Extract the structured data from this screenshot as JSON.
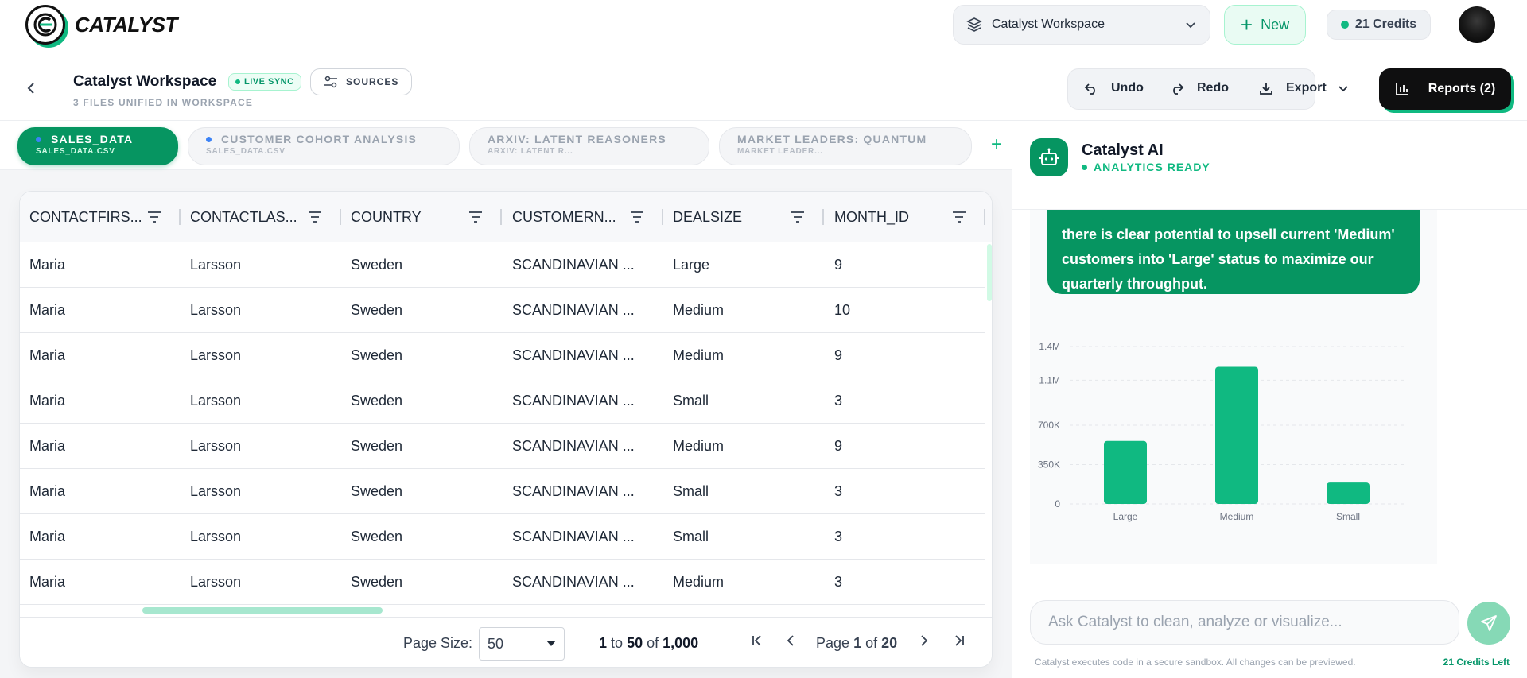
{
  "app": {
    "name": "CATALYST"
  },
  "topbar": {
    "workspace_selector": "Catalyst Workspace",
    "new_label": "New",
    "credits": "21 Credits"
  },
  "subbar": {
    "title": "Catalyst Workspace",
    "live_sync": "LIVE SYNC",
    "sources": "SOURCES",
    "subtitle": "3 FILES UNIFIED IN WORKSPACE",
    "undo": "Undo",
    "redo": "Redo",
    "export": "Export",
    "reports": "Reports (2)"
  },
  "tabs": [
    {
      "title": "SALES_DATA",
      "file": "SALES_DATA.CSV",
      "active": true
    },
    {
      "title": "CUSTOMER COHORT ANALYSIS",
      "file": "SALES_DATA.CSV",
      "active": false
    },
    {
      "title": "ARXIV: LATENT REASONERS",
      "file": "ARXIV: LATENT R...",
      "active": false
    },
    {
      "title": "MARKET LEADERS: QUANTUM",
      "file": "MARKET LEADER...",
      "active": false
    }
  ],
  "table": {
    "columns": [
      "CONTACTFIRS...",
      "CONTACTLAS...",
      "COUNTRY",
      "CUSTOMERN...",
      "DEALSIZE",
      "MONTH_ID"
    ],
    "rows": [
      [
        "Maria",
        "Larsson",
        "Sweden",
        "SCANDINAVIAN ...",
        "Large",
        "9"
      ],
      [
        "Maria",
        "Larsson",
        "Sweden",
        "SCANDINAVIAN ...",
        "Medium",
        "10"
      ],
      [
        "Maria",
        "Larsson",
        "Sweden",
        "SCANDINAVIAN ...",
        "Medium",
        "9"
      ],
      [
        "Maria",
        "Larsson",
        "Sweden",
        "SCANDINAVIAN ...",
        "Small",
        "3"
      ],
      [
        "Maria",
        "Larsson",
        "Sweden",
        "SCANDINAVIAN ...",
        "Medium",
        "9"
      ],
      [
        "Maria",
        "Larsson",
        "Sweden",
        "SCANDINAVIAN ...",
        "Small",
        "3"
      ],
      [
        "Maria",
        "Larsson",
        "Sweden",
        "SCANDINAVIAN ...",
        "Small",
        "3"
      ],
      [
        "Maria",
        "Larsson",
        "Sweden",
        "SCANDINAVIAN ...",
        "Medium",
        "3"
      ]
    ]
  },
  "pager": {
    "page_size_label": "Page Size:",
    "page_size": "50",
    "range_from": "1",
    "range_to": "50",
    "total": "1,000",
    "to": "to",
    "of": "of",
    "page_label": "Page",
    "page": "1",
    "page_of": "of",
    "pages": "20"
  },
  "ai": {
    "title": "Catalyst AI",
    "status": "ANALYTICS READY",
    "message": "there is clear potential to upsell current 'Medium' customers into 'Large' status to maximize our quarterly throughput.",
    "input_placeholder": "Ask Catalyst to clean, analyze or visualize...",
    "footnote": "Catalyst executes code in a secure sandbox. All changes can be previewed.",
    "credits_left": "21 Credits Left"
  },
  "colors": {
    "accent": "#069561",
    "bar": "#10b981"
  },
  "chart_data": {
    "type": "bar",
    "categories": [
      "Large",
      "Medium",
      "Small"
    ],
    "values": [
      560000,
      1220000,
      190000
    ],
    "ylim": [
      0,
      1400000
    ],
    "yticks": [
      0,
      350000,
      700000,
      1100000,
      1400000
    ],
    "ytick_labels": [
      "0",
      "350K",
      "700K",
      "1.1M",
      "1.4M"
    ],
    "grid": true
  }
}
